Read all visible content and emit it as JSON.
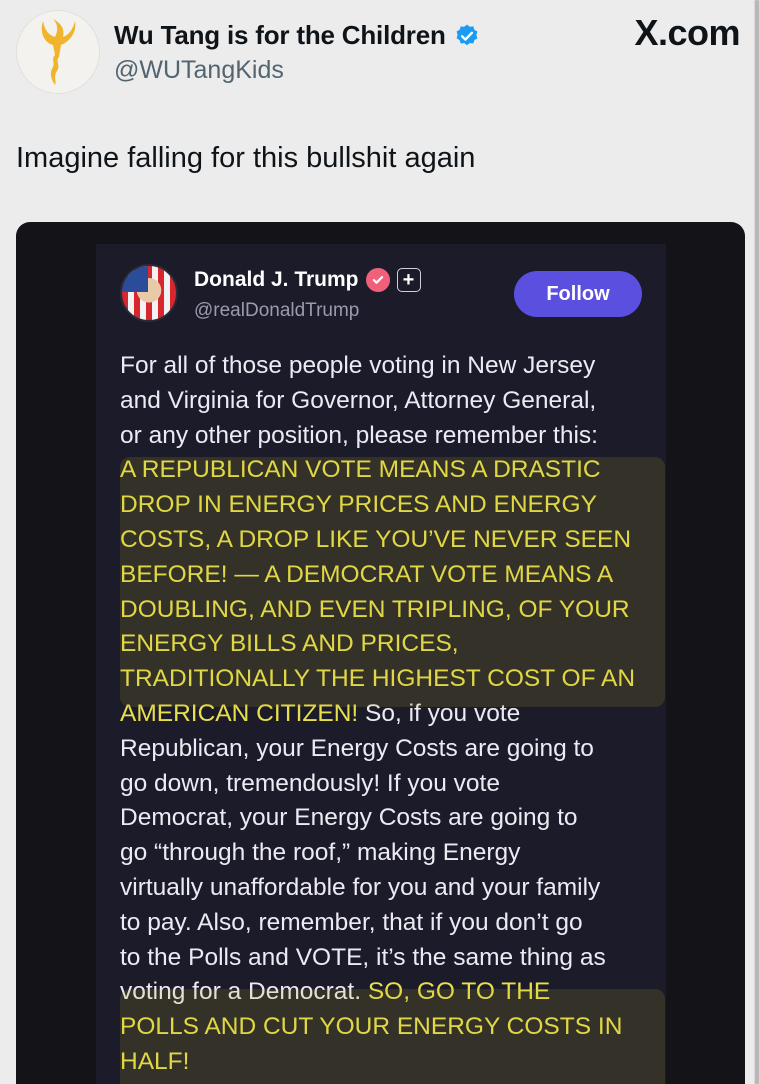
{
  "author": {
    "name": "Wu Tang is for the Children",
    "handle": "@WUTangKids",
    "verified": true,
    "avatar_icon": "wu-tang-logo-icon"
  },
  "brand": "X.com",
  "tweet_text": "Imagine falling for this bullshit again",
  "embedded_post": {
    "name": "Donald J. Trump",
    "handle": "@realDonaldTrump",
    "follow_label": "Follow",
    "follow_color": "#5b4fe0",
    "highlight_color": "#e8e04a",
    "lines": [
      {
        "t": "For all of those people voting in New Jersey"
      },
      {
        "t": "and Virginia for Governor, Attorney General,"
      },
      {
        "t": "or any other position, please remember this:"
      },
      {
        "h": "A REPUBLICAN VOTE MEANS A DRASTIC"
      },
      {
        "h": "DROP IN ENERGY PRICES AND ENERGY"
      },
      {
        "h": "COSTS, A DROP LIKE YOU’VE NEVER SEEN"
      },
      {
        "h": "BEFORE! — A DEMOCRAT VOTE MEANS A"
      },
      {
        "h": "DOUBLING, AND EVEN TRIPLING, OF YOUR"
      },
      {
        "h": "ENERGY BILLS AND PRICES,"
      },
      {
        "h": "TRADITIONALLY THE HIGHEST COST OF AN"
      },
      {
        "h": "AMERICAN CITIZEN!",
        "t": " So, if you vote"
      },
      {
        "t": "Republican, your Energy Costs are going to"
      },
      {
        "t": "go down, tremendously! If you vote"
      },
      {
        "t": "Democrat, your Energy Costs are going to"
      },
      {
        "t": "go “through the roof,” making Energy"
      },
      {
        "t": "virtually unaffordable for you and your family"
      },
      {
        "t": "to pay. Also, remember, that if you don’t go"
      },
      {
        "t": "to the Polls and VOTE, it’s the same thing as"
      },
      {
        "t": "voting for a Democrat. ",
        "h": "SO, GO TO THE",
        "hAfter": true
      },
      {
        "h": "POLLS AND CUT YOUR ENERGY COSTS IN"
      },
      {
        "h": "HALF!"
      }
    ]
  }
}
